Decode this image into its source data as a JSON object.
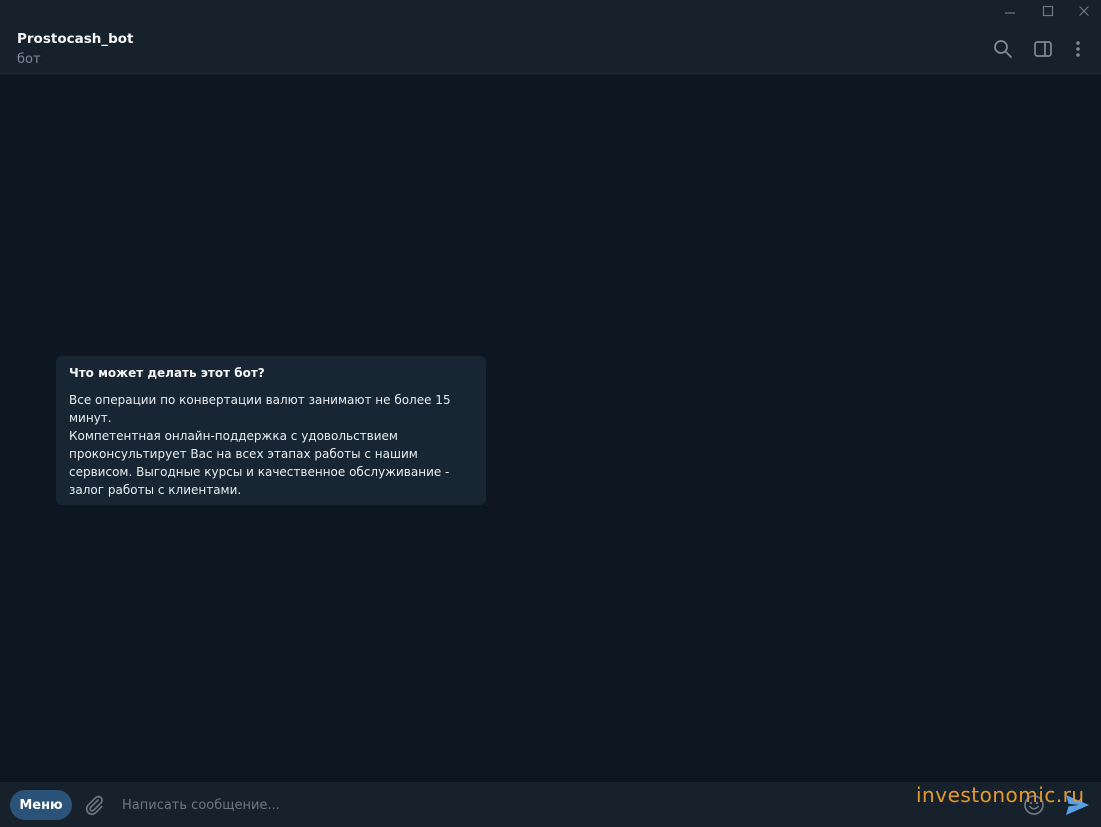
{
  "chat": {
    "title": "Prostocash_bot",
    "status": "бот"
  },
  "header_icons": [
    "search-icon",
    "sidebar-toggle-icon",
    "more-icon"
  ],
  "window_controls": [
    "minimize-icon",
    "maximize-icon",
    "close-icon"
  ],
  "bot_info": {
    "title": "Что может делать этот бот?",
    "description": "Все операции по конвертации валют занимают не более 15\nминут.\nКомпетентная онлайн-поддержка с удовольствием\nпроконсультирует Вас на всех этапах работы с нашим\nсервисом. Выгодные курсы и качественное обслуживание -\nзалог работы с клиентами."
  },
  "composer": {
    "menu_label": "Меню",
    "placeholder": "Написать сообщение..."
  },
  "watermark": "investonomic.ru",
  "colors": {
    "background": "#0e1621",
    "panel": "#17212b",
    "bubble": "#182533",
    "accent": "#2b5278",
    "send": "#5aa0e6",
    "watermark": "#e49b2c"
  }
}
